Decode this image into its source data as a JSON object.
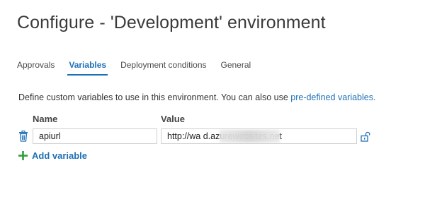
{
  "header": {
    "title": "Configure - 'Development' environment"
  },
  "tabs": [
    {
      "label": "Approvals",
      "active": false
    },
    {
      "label": "Variables",
      "active": true
    },
    {
      "label": "Deployment conditions",
      "active": false
    },
    {
      "label": "General",
      "active": false
    }
  ],
  "variables_panel": {
    "description": "Define custom variables to use in this environment. You can also use ",
    "predefined_link": "pre-defined variables.",
    "name_header": "Name",
    "value_header": "Value",
    "rows": [
      {
        "name": "apiurl",
        "value": "http://wa                        d.azurewebsites.net"
      }
    ],
    "add_label": "Add variable"
  },
  "icons": {
    "delete": "trash-icon",
    "secret": "unlock-icon",
    "add": "plus-icon"
  },
  "colors": {
    "accent": "#1e70b6",
    "add_plus": "#2f9e3a"
  }
}
